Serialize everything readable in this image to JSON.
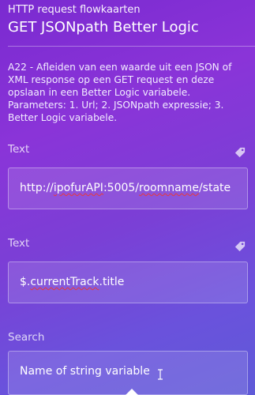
{
  "header": {
    "subtitle": "HTTP request flowkaarten",
    "title": "GET JSONpath Better Logic"
  },
  "description": "A22 - Afleiden van een waarde uit een JSON of XML response op een GET request en deze opslaan in een Better Logic variabele. Parameters: 1. Url; 2. JSONpath expressie; 3. Better Logic variabele.",
  "fields": [
    {
      "label": "Text",
      "value_parts": [
        "http://",
        "ipofurAPI",
        ":5005/",
        "roomname",
        "/state"
      ],
      "icon": "tag-icon"
    },
    {
      "label": "Text",
      "value_parts": [
        "$.",
        "currentTrack",
        ".title"
      ],
      "icon": "tag-icon"
    },
    {
      "label": "Search",
      "value": "Name of string variable",
      "icon": "text-cursor-icon"
    }
  ],
  "colors": {
    "background_top": "#7a2ad0",
    "background_bottom": "#5f5ad8",
    "spellcheck": "#e83a3a"
  }
}
